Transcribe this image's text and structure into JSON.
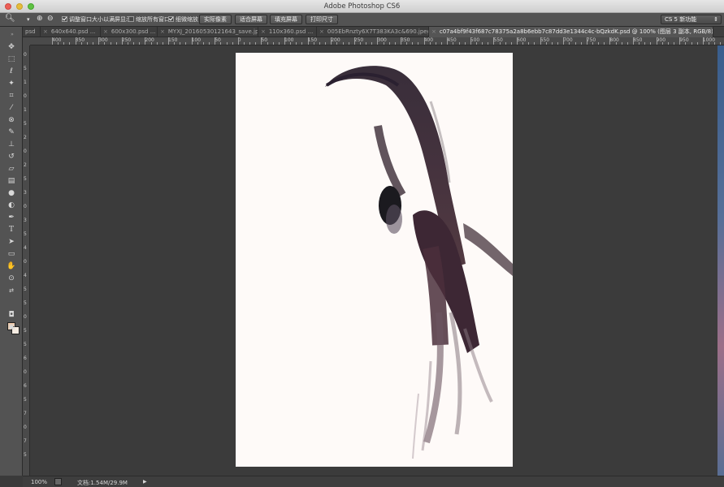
{
  "window": {
    "title": "Adobe Photoshop CS6"
  },
  "options_bar": {
    "zoom_tool_icon": "zoom-icon",
    "checkbox_resize_windows": {
      "label": "调整窗口大小以满屏显示",
      "checked": true
    },
    "checkbox_zoom_all": {
      "label": "缩放所有窗口",
      "checked": false
    },
    "checkbox_scrubby_zoom": {
      "label": "细微缩放",
      "checked": true
    },
    "btn_actual_pixels": "实际像素",
    "btn_fit_screen": "适合屏幕",
    "btn_fill_screen": "填充屏幕",
    "btn_print_size": "打印尺寸",
    "workspace": "CS 5 新功能"
  },
  "tabs": [
    {
      "label": "psd",
      "active": false
    },
    {
      "label": "640x640.psd ...",
      "active": false
    },
    {
      "label": "600x300.psd ...",
      "active": false
    },
    {
      "label": "MYXJ_20160530121643_save.jpg",
      "active": false
    },
    {
      "label": "110x360.psd ...",
      "active": false
    },
    {
      "label": "005EbRnzty6X7T383KA3c&690.jpeg",
      "active": false
    },
    {
      "label": "c07a4bf9f43f687c78375a2a8b6ebb7c87dd3e1344c4c-bQzkdK.psd @ 100% (图层 3 副本, RGB/8) *",
      "active": true
    }
  ],
  "ruler": {
    "h_labels": [
      "400",
      "350",
      "300",
      "250",
      "200",
      "150",
      "100",
      "50",
      "0",
      "50",
      "100",
      "150",
      "200",
      "250",
      "300",
      "350",
      "400",
      "450",
      "500",
      "550",
      "600",
      "650",
      "700",
      "750",
      "800",
      "850",
      "900",
      "950",
      "1000"
    ],
    "v_labels": [
      "0",
      "5",
      "1",
      "0",
      "1",
      "5",
      "2",
      "0",
      "2",
      "5",
      "3",
      "0",
      "3",
      "5",
      "4",
      "0",
      "4",
      "5",
      "5",
      "0",
      "5",
      "5",
      "6",
      "0",
      "6",
      "5",
      "7",
      "0",
      "7",
      "5"
    ]
  },
  "colors": {
    "foreground": "#f1c9a6",
    "background": "#f6ece2"
  },
  "status": {
    "zoom": "100%",
    "doc": "文档:1.54M/29.9M"
  }
}
